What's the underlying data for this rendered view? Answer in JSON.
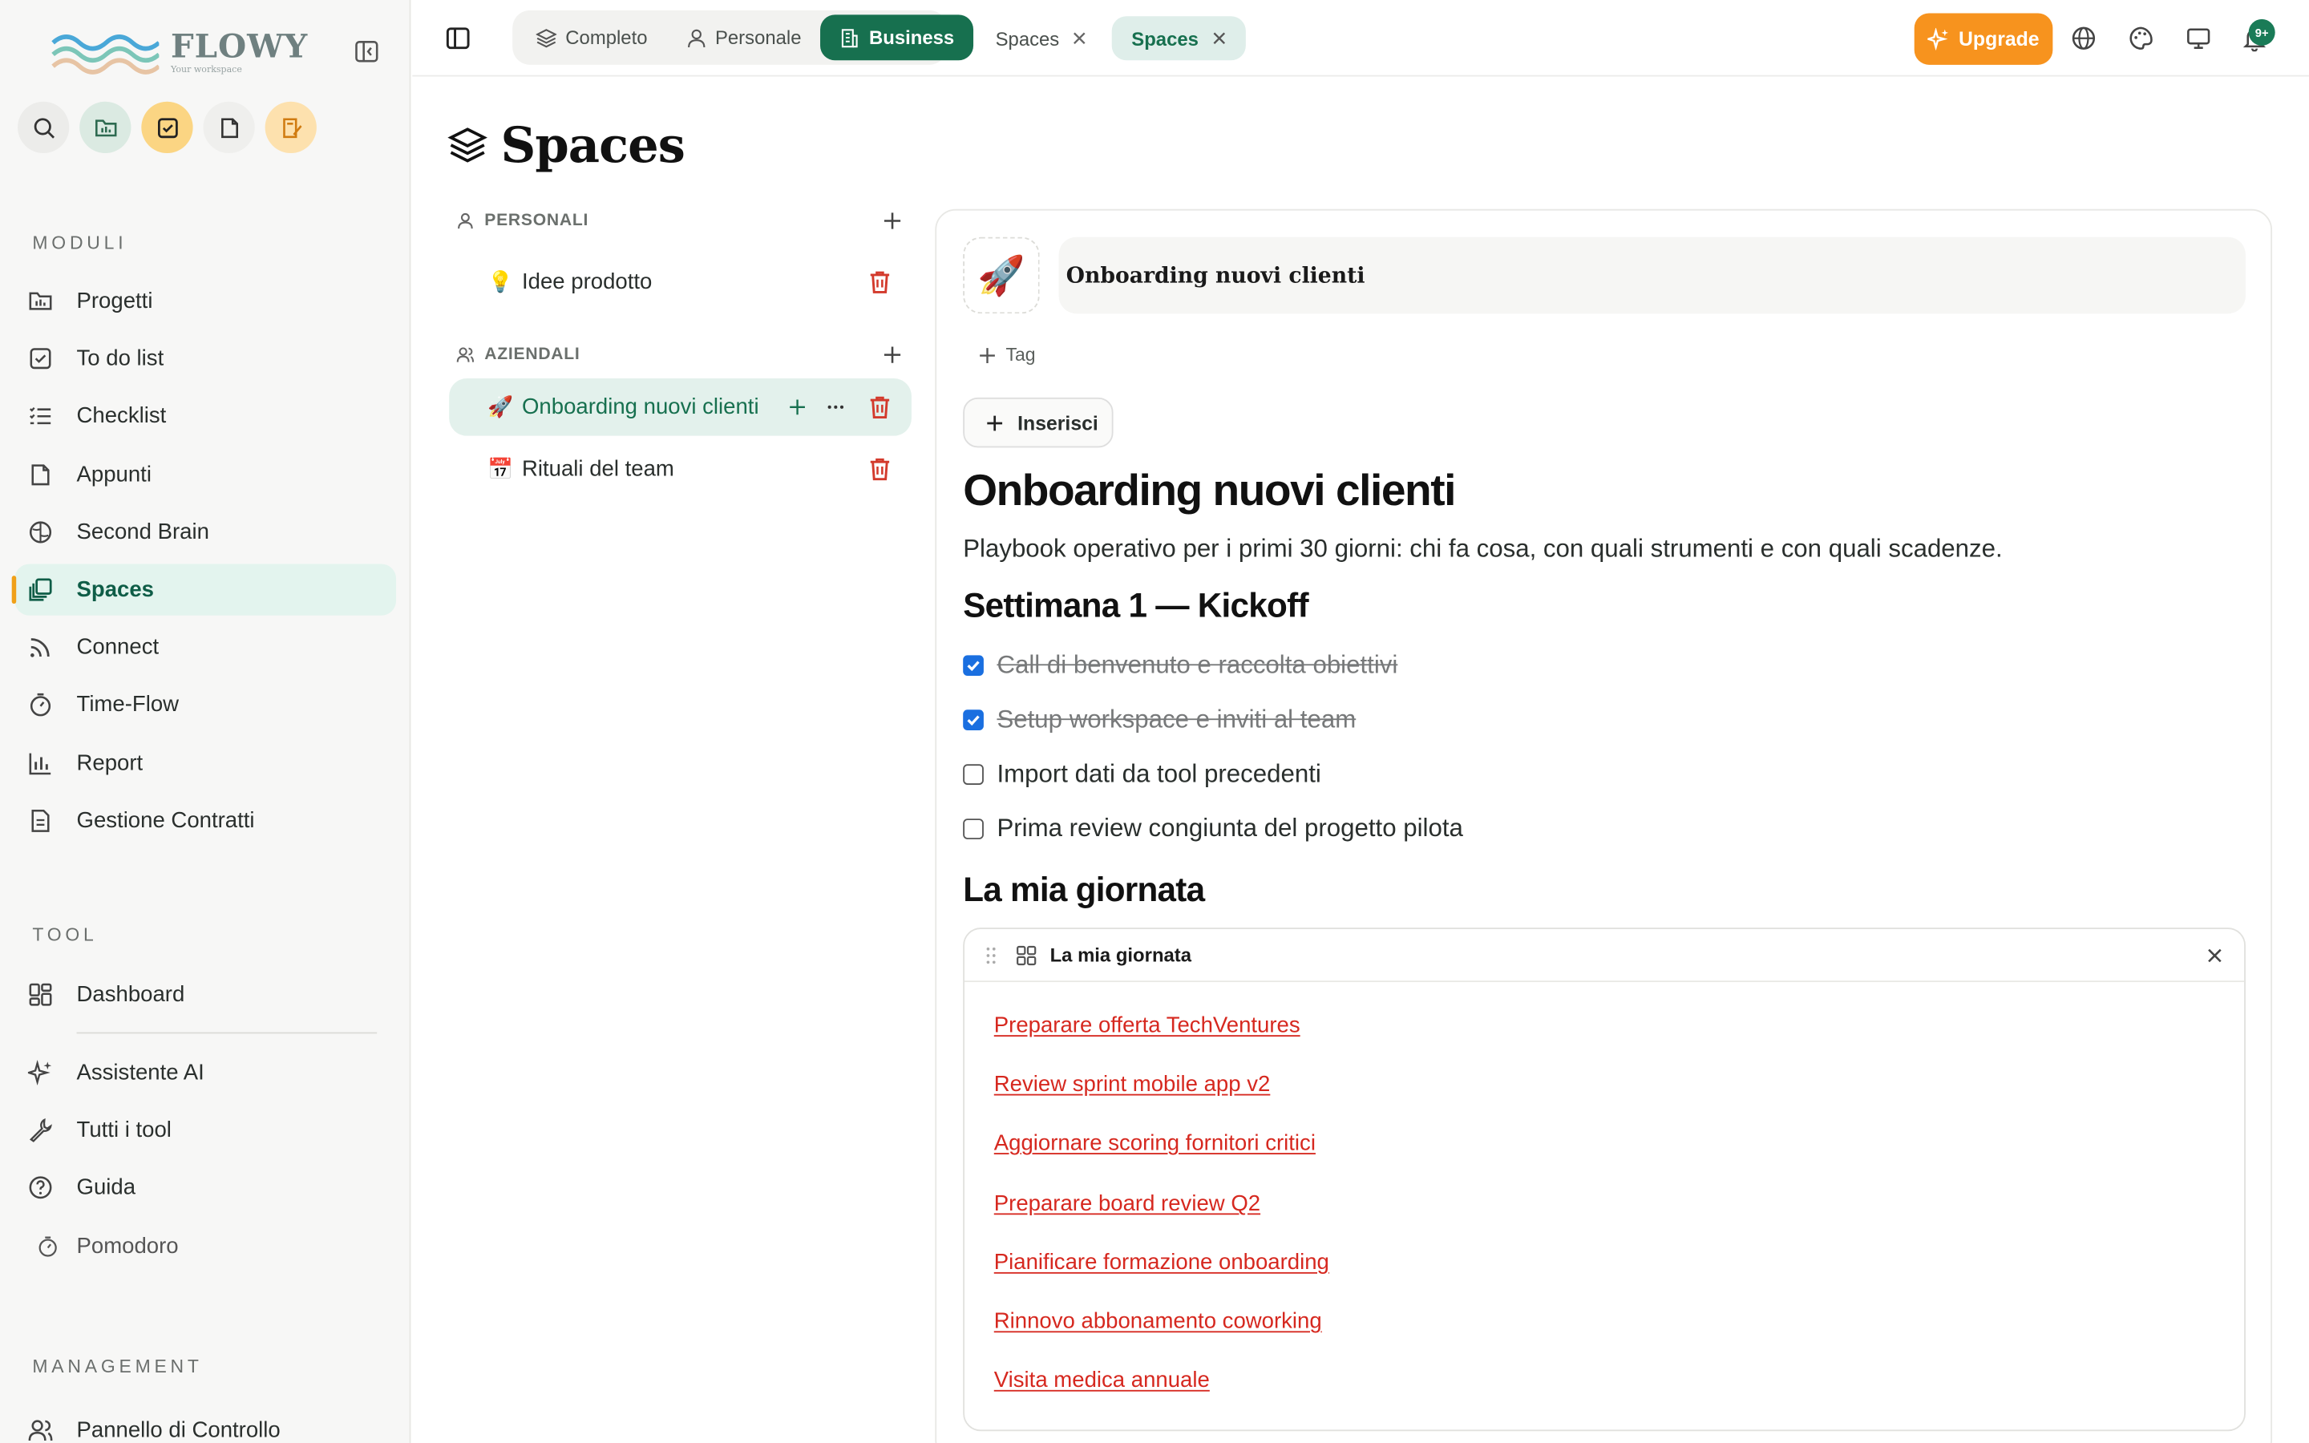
{
  "brand": {
    "name": "FLOWY",
    "tagline": "Your workspace"
  },
  "sidebar": {
    "sections": {
      "moduli": "MODULI",
      "tool": "TOOL",
      "management": "MANAGEMENT"
    },
    "moduli_items": [
      {
        "label": "Progetti",
        "icon": "folder-chart-icon"
      },
      {
        "label": "To do list",
        "icon": "checkbox-icon"
      },
      {
        "label": "Checklist",
        "icon": "list-check-icon"
      },
      {
        "label": "Appunti",
        "icon": "note-icon"
      },
      {
        "label": "Second Brain",
        "icon": "brain-icon"
      },
      {
        "label": "Spaces",
        "icon": "spaces-icon",
        "active": true
      },
      {
        "label": "Connect",
        "icon": "rss-icon"
      },
      {
        "label": "Time-Flow",
        "icon": "timer-icon"
      },
      {
        "label": "Report",
        "icon": "bar-chart-icon"
      },
      {
        "label": "Gestione Contratti",
        "icon": "contract-icon"
      }
    ],
    "tool_items": [
      {
        "label": "Dashboard",
        "icon": "dashboard-icon"
      },
      {
        "label": "Assistente AI",
        "icon": "sparkle-icon"
      },
      {
        "label": "Tutti i tool",
        "icon": "wrench-icon"
      },
      {
        "label": "Guida",
        "icon": "help-icon"
      },
      {
        "label": "Pomodoro",
        "icon": "timer-icon"
      }
    ],
    "management_items": [
      {
        "label": "Pannello di Controllo",
        "icon": "users-icon"
      }
    ]
  },
  "topbar": {
    "modes": [
      {
        "label": "Completo",
        "icon": "layers-icon"
      },
      {
        "label": "Personale",
        "icon": "user-icon"
      },
      {
        "label": "Business",
        "icon": "building-icon",
        "active": true
      }
    ],
    "tabs": [
      {
        "label": "Spaces",
        "active": false
      },
      {
        "label": "Spaces",
        "active": true
      }
    ],
    "upgrade_label": "Upgrade",
    "notification_badge": "9+"
  },
  "page": {
    "title": "Spaces"
  },
  "tree": {
    "groups": [
      {
        "label": "PERSONALI",
        "items": [
          {
            "emoji": "💡",
            "label": "Idee prodotto"
          }
        ]
      },
      {
        "label": "AZIENDALI",
        "items": [
          {
            "emoji": "🚀",
            "label": "Onboarding nuovi clienti",
            "active": true
          },
          {
            "emoji": "📅",
            "label": "Rituali del team"
          }
        ]
      }
    ]
  },
  "document": {
    "icon_emoji": "🚀",
    "title_field": "Onboarding nuovi clienti",
    "tag_label": "Tag",
    "insert_label": "Inserisci",
    "heading": "Onboarding nuovi clienti",
    "lead": "Playbook operativo per i primi 30 giorni: chi fa cosa, con quali strumenti e con quali scadenze.",
    "section1": "Settimana 1 — Kickoff",
    "checklist": [
      {
        "text": "Call di benvenuto e raccolta obiettivi",
        "checked": true
      },
      {
        "text": "Setup workspace e inviti al team",
        "checked": true
      },
      {
        "text": "Import dati da tool precedenti",
        "checked": false
      },
      {
        "text": "Prima review congiunta del progetto pilota",
        "checked": false
      }
    ],
    "section2": "La mia giornata",
    "widget": {
      "title": "La mia giornata",
      "tasks": [
        "Preparare offerta TechVentures",
        "Review sprint mobile app v2",
        "Aggiornare scoring fornitori critici",
        "Preparare board review Q2",
        "Pianificare formazione onboarding",
        "Rinnovo abbonamento coworking",
        "Visita medica annuale"
      ]
    }
  },
  "colors": {
    "accent": "#17704f",
    "upgrade": "#f7931e",
    "active_bg": "#e3f4ee",
    "task_link": "#d6281f",
    "danger": "#d33a2c"
  }
}
